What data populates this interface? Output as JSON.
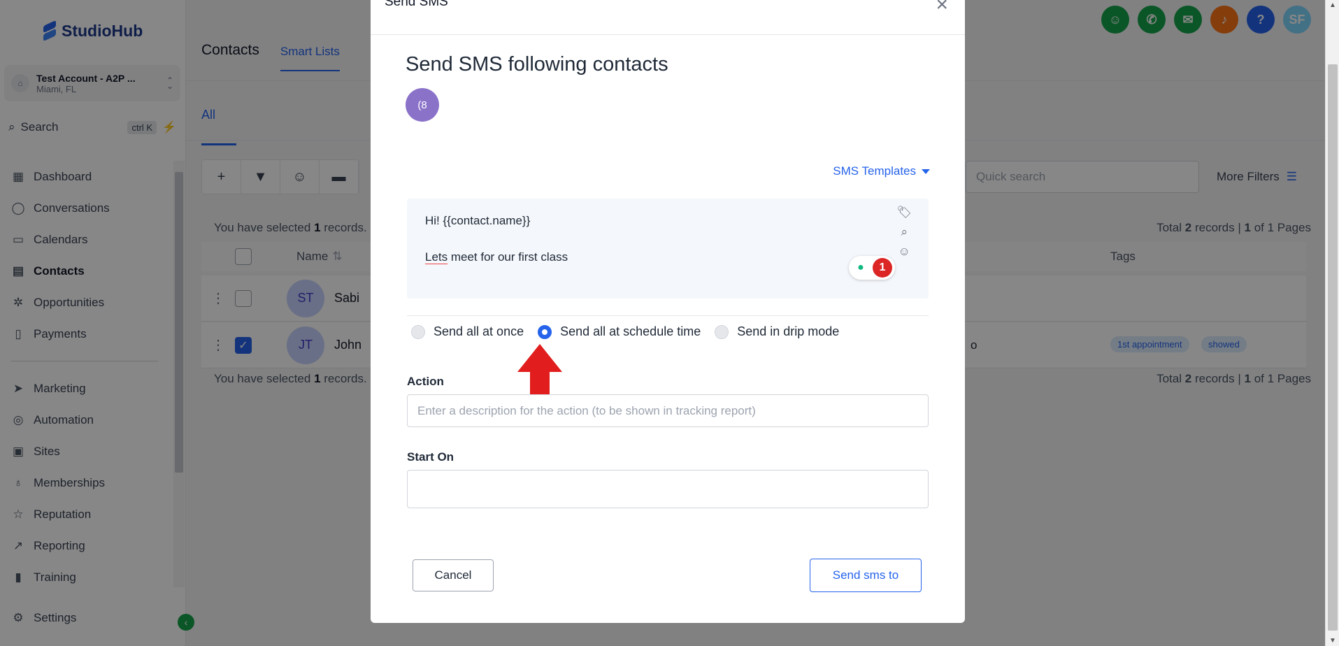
{
  "sidebar": {
    "brand": "StudioHub",
    "account": {
      "name": "Test Account - A2P ...",
      "location": "Miami, FL"
    },
    "search": {
      "label": "Search",
      "shortcut": "ctrl K"
    },
    "items": [
      {
        "label": "Dashboard",
        "icon": "dashboard-icon"
      },
      {
        "label": "Conversations",
        "icon": "chat-icon"
      },
      {
        "label": "Calendars",
        "icon": "calendar-icon"
      },
      {
        "label": "Contacts",
        "icon": "contacts-icon"
      },
      {
        "label": "Opportunities",
        "icon": "opportunities-icon"
      },
      {
        "label": "Payments",
        "icon": "payments-icon"
      }
    ],
    "items2": [
      {
        "label": "Marketing",
        "icon": "send-icon"
      },
      {
        "label": "Automation",
        "icon": "automation-icon"
      },
      {
        "label": "Sites",
        "icon": "sites-icon"
      },
      {
        "label": "Memberships",
        "icon": "memberships-icon"
      },
      {
        "label": "Reputation",
        "icon": "star-icon"
      },
      {
        "label": "Reporting",
        "icon": "chart-icon"
      },
      {
        "label": "Training",
        "icon": "book-icon"
      }
    ],
    "settings": "Settings"
  },
  "header": {
    "tab_contacts": "Contacts",
    "tab_smart_lists": "Smart Lists",
    "user_initials": "SF",
    "help": "?"
  },
  "list": {
    "filter_tab": "All",
    "quick_search_placeholder": "Quick search",
    "more_filters": "More Filters",
    "selected_prefix": "You have selected",
    "selected_count": "1",
    "selected_suffix": "records.",
    "total_prefix": "Total",
    "total_count": "2",
    "total_mid": "records |",
    "page_current": "1",
    "page_of": "of 1 Pages",
    "col_name": "Name",
    "col_tags": "Tags",
    "rows": [
      {
        "initials": "ST",
        "name": "Sabi",
        "checked": false
      },
      {
        "initials": "JT",
        "name": "John",
        "checked": true,
        "tags": [
          "1st appointment",
          "showed"
        ],
        "extra": "o"
      }
    ]
  },
  "modal": {
    "header_title": "Send SMS",
    "close": "×",
    "title": "Send SMS following contacts",
    "chip": "(8",
    "templates_label": "SMS Templates",
    "message_line1": "Hi! {{contact.name}}",
    "message_word": "Lets",
    "message_rest": " meet for our first class",
    "grammar_count": "1",
    "radio_once": "Send all at once",
    "radio_schedule": "Send all at schedule time",
    "radio_drip": "Send in drip mode",
    "selected_mode": "schedule",
    "action_label": "Action",
    "action_placeholder": "Enter a description for the action (to be shown in tracking report)",
    "start_label": "Start On",
    "start_value": "",
    "cancel": "Cancel",
    "send": "Send sms to"
  },
  "colors": {
    "primary": "#2563eb",
    "arrow": "#e11d1d",
    "chip": "#8b72c9"
  }
}
